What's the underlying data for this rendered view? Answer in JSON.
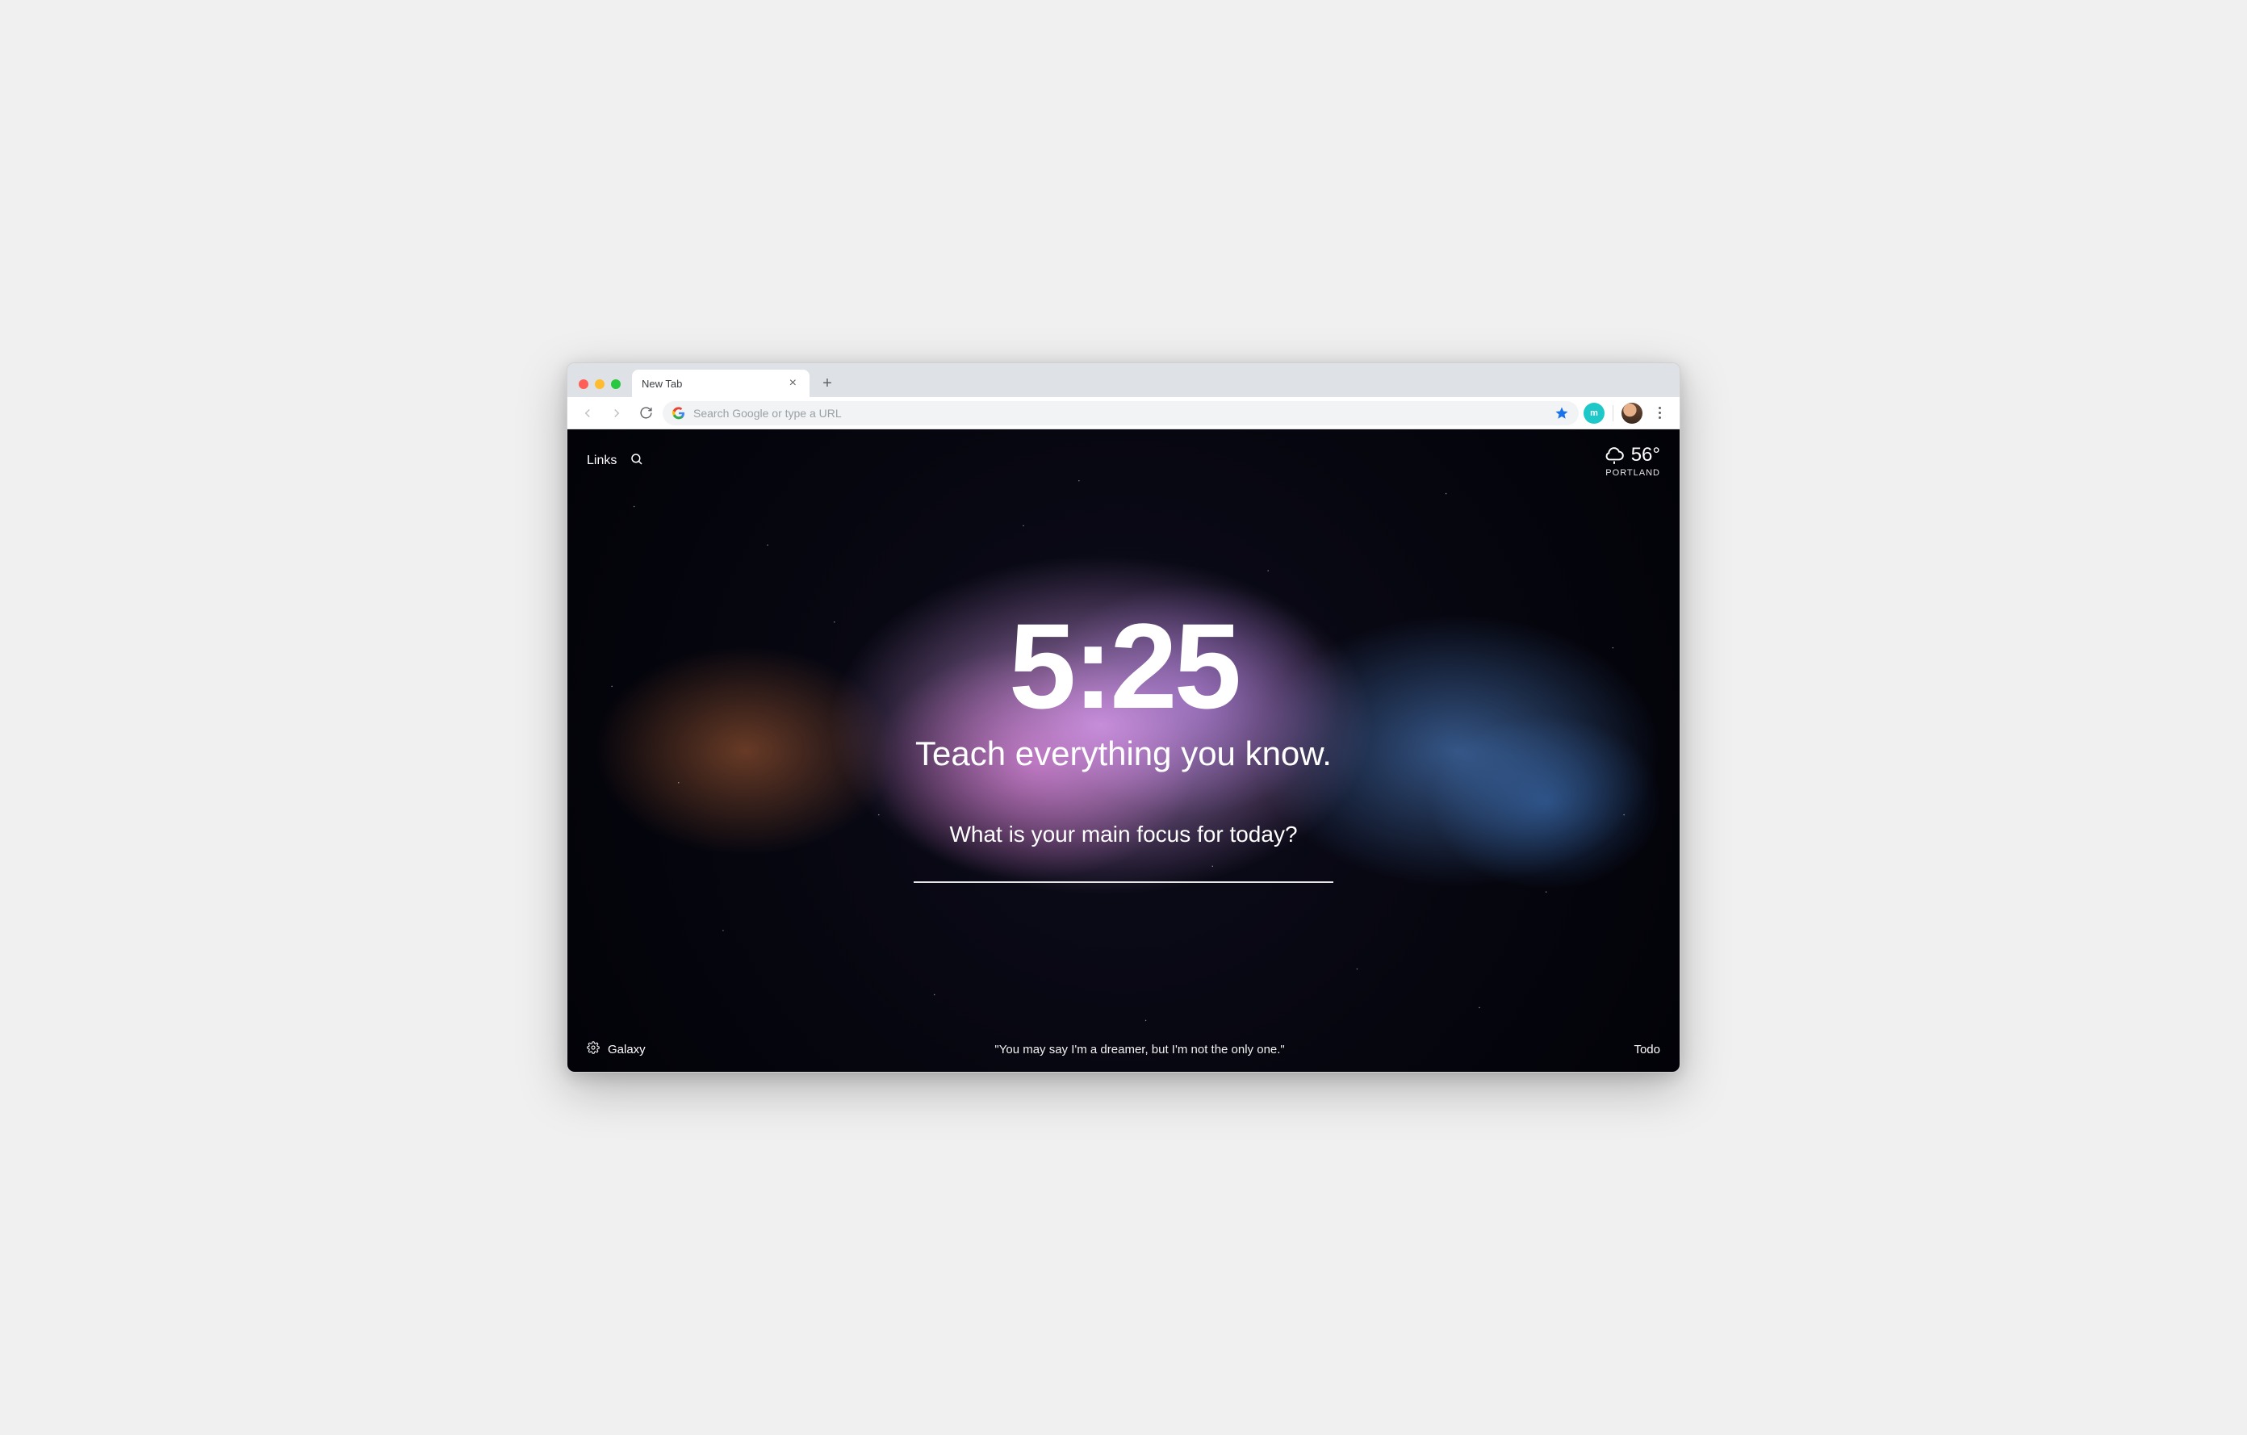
{
  "browser": {
    "tab_title": "New Tab",
    "omnibox_placeholder": "Search Google or type a URL",
    "extension_initial": "m"
  },
  "top": {
    "links_label": "Links",
    "weather_temp": "56°",
    "weather_city": "PORTLAND"
  },
  "center": {
    "time": "5:25",
    "mantra": "Teach everything you know.",
    "focus_question": "What is your main focus for today?"
  },
  "bottom": {
    "photo_label": "Galaxy",
    "quote": "\"You may say I'm a dreamer, but I'm not the only one.\"",
    "todo_label": "Todo"
  }
}
